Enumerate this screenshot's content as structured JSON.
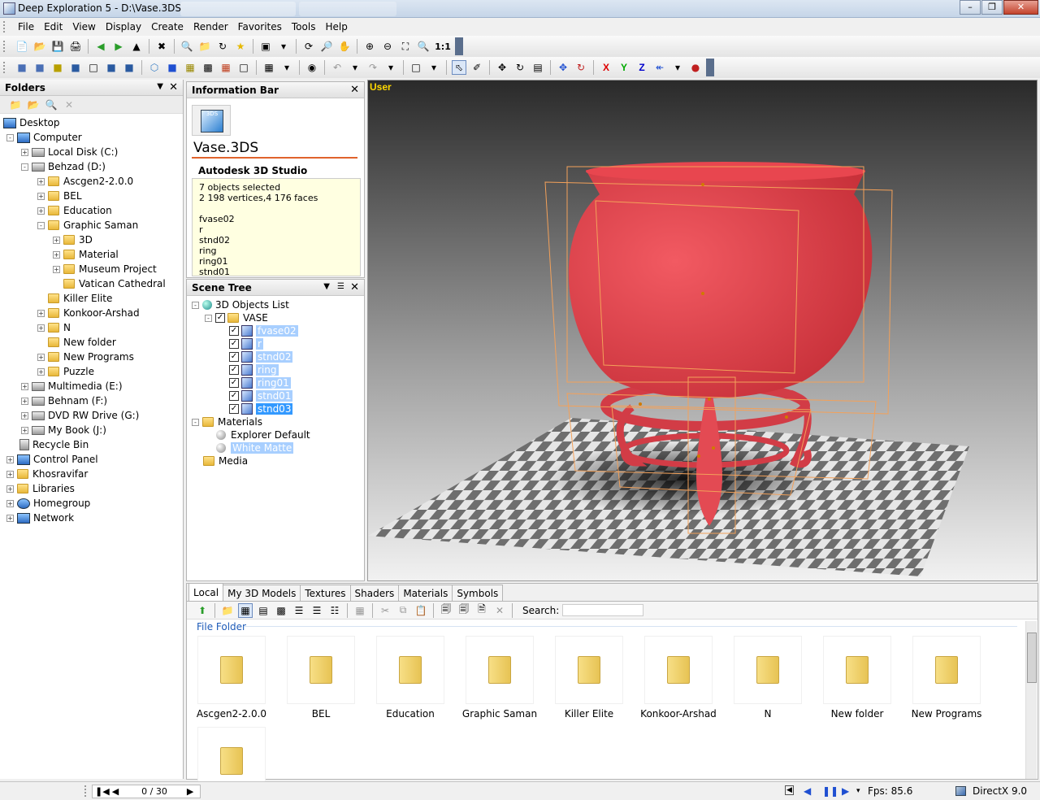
{
  "window": {
    "title": "Deep Exploration 5 - D:\\Vase.3DS"
  },
  "menubar": {
    "items": [
      {
        "label": "File"
      },
      {
        "label": "Edit"
      },
      {
        "label": "View"
      },
      {
        "label": "Display"
      },
      {
        "label": "Create"
      },
      {
        "label": "Render"
      },
      {
        "label": "Favorites"
      },
      {
        "label": "Tools"
      },
      {
        "label": "Help"
      }
    ]
  },
  "toolbar": {
    "zoom_ratio": "1:1",
    "axis_x": "X",
    "axis_y": "Y",
    "axis_z": "Z"
  },
  "folders": {
    "title": "Folders",
    "items": [
      {
        "label": "Desktop"
      },
      {
        "label": "Computer"
      },
      {
        "label": "Local Disk (C:)"
      },
      {
        "label": "Behzad (D:)"
      },
      {
        "label": "Ascgen2-2.0.0"
      },
      {
        "label": "BEL"
      },
      {
        "label": "Education"
      },
      {
        "label": "Graphic Saman"
      },
      {
        "label": "3D"
      },
      {
        "label": "Material"
      },
      {
        "label": "Museum Project"
      },
      {
        "label": "Vatican Cathedral"
      },
      {
        "label": "Killer Elite"
      },
      {
        "label": "Konkoor-Arshad"
      },
      {
        "label": "N"
      },
      {
        "label": "New folder"
      },
      {
        "label": "New Programs"
      },
      {
        "label": "Puzzle"
      },
      {
        "label": "Multimedia (E:)"
      },
      {
        "label": "Behnam (F:)"
      },
      {
        "label": "DVD RW Drive (G:)"
      },
      {
        "label": "My Book (J:)"
      },
      {
        "label": "Recycle Bin"
      },
      {
        "label": "Control Panel"
      },
      {
        "label": "Khosravifar"
      },
      {
        "label": "Libraries"
      },
      {
        "label": "Homegroup"
      },
      {
        "label": "Network"
      }
    ]
  },
  "infobar": {
    "title": "Information Bar",
    "icon_label": "3DS",
    "filename": "Vase.3DS",
    "type": "Autodesk 3D Studio",
    "lines": [
      "7 objects selected",
      "2 198 vertices,4 176 faces",
      "",
      "fvase02",
      "r",
      "stnd02",
      "ring",
      "ring01",
      "stnd01"
    ]
  },
  "scenetree": {
    "title": "Scene Tree",
    "root": "3D Objects List",
    "group": "VASE",
    "objects": [
      {
        "label": "fvase02"
      },
      {
        "label": "r"
      },
      {
        "label": "stnd02"
      },
      {
        "label": "ring"
      },
      {
        "label": "ring01"
      },
      {
        "label": "stnd01"
      },
      {
        "label": "stnd03"
      }
    ],
    "materials_label": "Materials",
    "materials": [
      {
        "label": "Explorer Default"
      },
      {
        "label": "White Matte"
      }
    ],
    "media_label": "Media"
  },
  "viewport": {
    "label": "User"
  },
  "lower": {
    "tabs": [
      {
        "label": "Local"
      },
      {
        "label": "My 3D Models"
      },
      {
        "label": "Textures"
      },
      {
        "label": "Shaders"
      },
      {
        "label": "Materials"
      },
      {
        "label": "Symbols"
      }
    ],
    "search_label": "Search:",
    "search_value": "",
    "section": "File Folder",
    "tiles": [
      {
        "label": "Ascgen2-2.0.0"
      },
      {
        "label": "BEL"
      },
      {
        "label": "Education"
      },
      {
        "label": "Graphic Saman"
      },
      {
        "label": "Killer Elite"
      },
      {
        "label": "Konkoor-Arshad"
      },
      {
        "label": "N"
      },
      {
        "label": "New folder"
      },
      {
        "label": "New Programs"
      },
      {
        "label": ""
      }
    ]
  },
  "status": {
    "page": "0 / 30",
    "fps": "Fps: 85.6",
    "renderer": "DirectX 9.0"
  },
  "colors": {
    "accent": "#3399ff",
    "vase": "#e8464f",
    "bbox": "#f3a15a"
  }
}
